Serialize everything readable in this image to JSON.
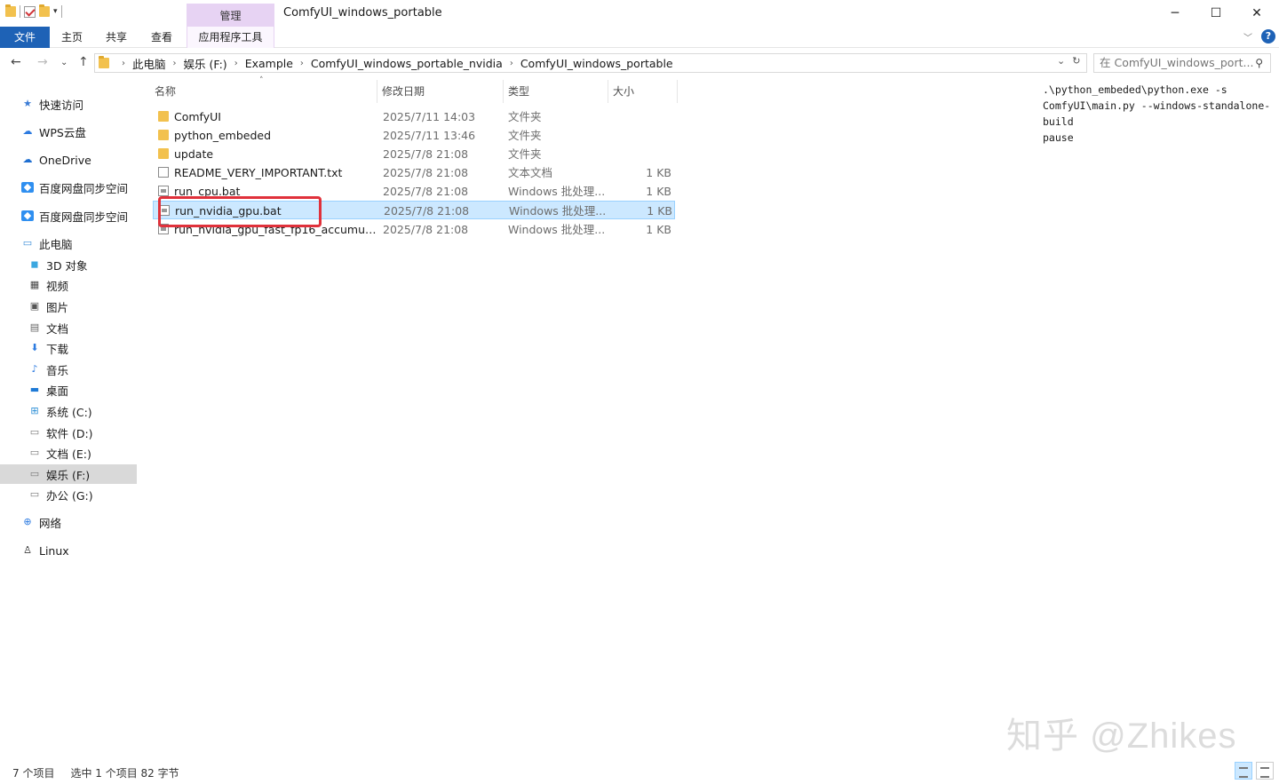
{
  "window": {
    "title": "ComfyUI_windows_portable",
    "manage_tab": "管理",
    "minimize": "─",
    "maximize": "☐",
    "close": "✕"
  },
  "ribbon": {
    "tabs": [
      {
        "label": "文件"
      },
      {
        "label": "主页"
      },
      {
        "label": "共享"
      },
      {
        "label": "查看"
      },
      {
        "label": "应用程序工具"
      }
    ],
    "help": "?"
  },
  "address": {
    "crumbs": [
      "此电脑",
      "娱乐 (F:)",
      "Example",
      "ComfyUI_windows_portable_nvidia",
      "ComfyUI_windows_portable"
    ],
    "search_placeholder": "在 ComfyUI_windows_port..."
  },
  "sidebar": {
    "items": [
      {
        "label": "快速访问",
        "icon": "star-icon"
      },
      {
        "label": "WPS云盘",
        "icon": "cloud-icon"
      },
      {
        "label": "OneDrive",
        "icon": "onedrive-icon"
      },
      {
        "label": "百度网盘同步空间",
        "icon": "baidu-icon"
      },
      {
        "label": "百度网盘同步空间",
        "icon": "baidu-icon"
      },
      {
        "label": "此电脑",
        "icon": "computer-icon"
      },
      {
        "label": "3D 对象",
        "icon": "cube-icon"
      },
      {
        "label": "视频",
        "icon": "video-icon"
      },
      {
        "label": "图片",
        "icon": "picture-icon"
      },
      {
        "label": "文档",
        "icon": "document-icon"
      },
      {
        "label": "下载",
        "icon": "download-icon"
      },
      {
        "label": "音乐",
        "icon": "music-icon"
      },
      {
        "label": "桌面",
        "icon": "desktop-icon"
      },
      {
        "label": "系统 (C:)",
        "icon": "windows-drive-icon"
      },
      {
        "label": "软件 (D:)",
        "icon": "drive-icon"
      },
      {
        "label": "文档 (E:)",
        "icon": "drive-icon"
      },
      {
        "label": "娱乐 (F:)",
        "icon": "drive-icon"
      },
      {
        "label": "办公 (G:)",
        "icon": "drive-icon"
      },
      {
        "label": "网络",
        "icon": "network-icon"
      },
      {
        "label": "Linux",
        "icon": "linux-icon"
      }
    ]
  },
  "list": {
    "columns": {
      "name": "名称",
      "date": "修改日期",
      "type": "类型",
      "size": "大小"
    },
    "rows": [
      {
        "name": "ComfyUI",
        "date": "2025/7/11 14:03",
        "type": "文件夹",
        "size": "",
        "icon": "folder-icon"
      },
      {
        "name": "python_embeded",
        "date": "2025/7/11 13:46",
        "type": "文件夹",
        "size": "",
        "icon": "folder-icon"
      },
      {
        "name": "update",
        "date": "2025/7/8 21:08",
        "type": "文件夹",
        "size": "",
        "icon": "folder-icon"
      },
      {
        "name": "README_VERY_IMPORTANT.txt",
        "date": "2025/7/8 21:08",
        "type": "文本文档",
        "size": "1 KB",
        "icon": "text-file-icon"
      },
      {
        "name": "run_cpu.bat",
        "date": "2025/7/8 21:08",
        "type": "Windows 批处理...",
        "size": "1 KB",
        "icon": "bat-file-icon"
      },
      {
        "name": "run_nvidia_gpu.bat",
        "date": "2025/7/8 21:08",
        "type": "Windows 批处理...",
        "size": "1 KB",
        "icon": "bat-file-icon"
      },
      {
        "name": "run_nvidia_gpu_fast_fp16_accumulati...",
        "date": "2025/7/8 21:08",
        "type": "Windows 批处理...",
        "size": "1 KB",
        "icon": "bat-file-icon"
      }
    ]
  },
  "preview": {
    "text": ".\\python_embeded\\python.exe -s\nComfyUI\\main.py --windows-standalone-\nbuild\npause"
  },
  "watermark": "知乎 @Zhikes",
  "status": {
    "count": "7 个项目",
    "selection": "选中 1 个项目  82 字节"
  },
  "colors": {
    "accent": "#1e62b6",
    "selected_row": "#cce8ff",
    "highlight_box": "#e0313b",
    "manage_tab": "#e7d3f3"
  }
}
